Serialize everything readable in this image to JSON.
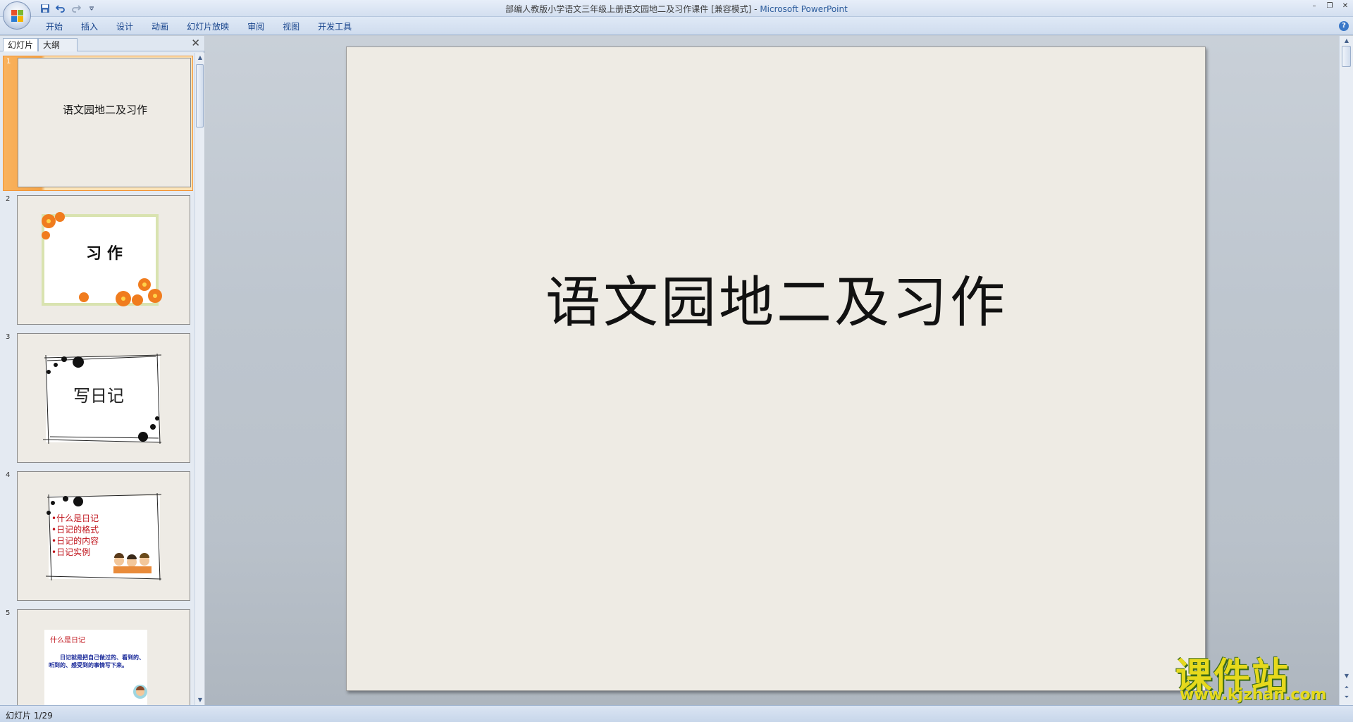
{
  "window": {
    "title": "部编人教版小学语文三年级上册语文园地二及习作课件 [兼容模式]",
    "app_name": "Microsoft PowerPoint",
    "qat_icons": [
      "save-icon",
      "undo-icon",
      "redo-icon",
      "customize-icon"
    ]
  },
  "ribbon": {
    "tabs": [
      "开始",
      "插入",
      "设计",
      "动画",
      "幻灯片放映",
      "审阅",
      "视图",
      "开发工具"
    ]
  },
  "panel": {
    "tab_slides": "幻灯片",
    "tab_outline": "大纲",
    "thumbs": [
      {
        "num": "1",
        "title": "语文园地二及习作"
      },
      {
        "num": "2",
        "title": "习 作"
      },
      {
        "num": "3",
        "title": "写日记"
      },
      {
        "num": "4",
        "items": [
          "•什么是日记",
          "•日记的格式",
          "•日记的内容",
          "•日记实例"
        ]
      },
      {
        "num": "5",
        "heading": "什么是日记",
        "body": "日记就是把自己做过的、看到的、听到的、感受到的事情写下来。"
      }
    ]
  },
  "slide": {
    "title": "语文园地二及习作"
  },
  "status": {
    "text": "幻灯片 1/29"
  },
  "watermark": {
    "cn": "课件站",
    "url": "www.kjzhan.com"
  }
}
